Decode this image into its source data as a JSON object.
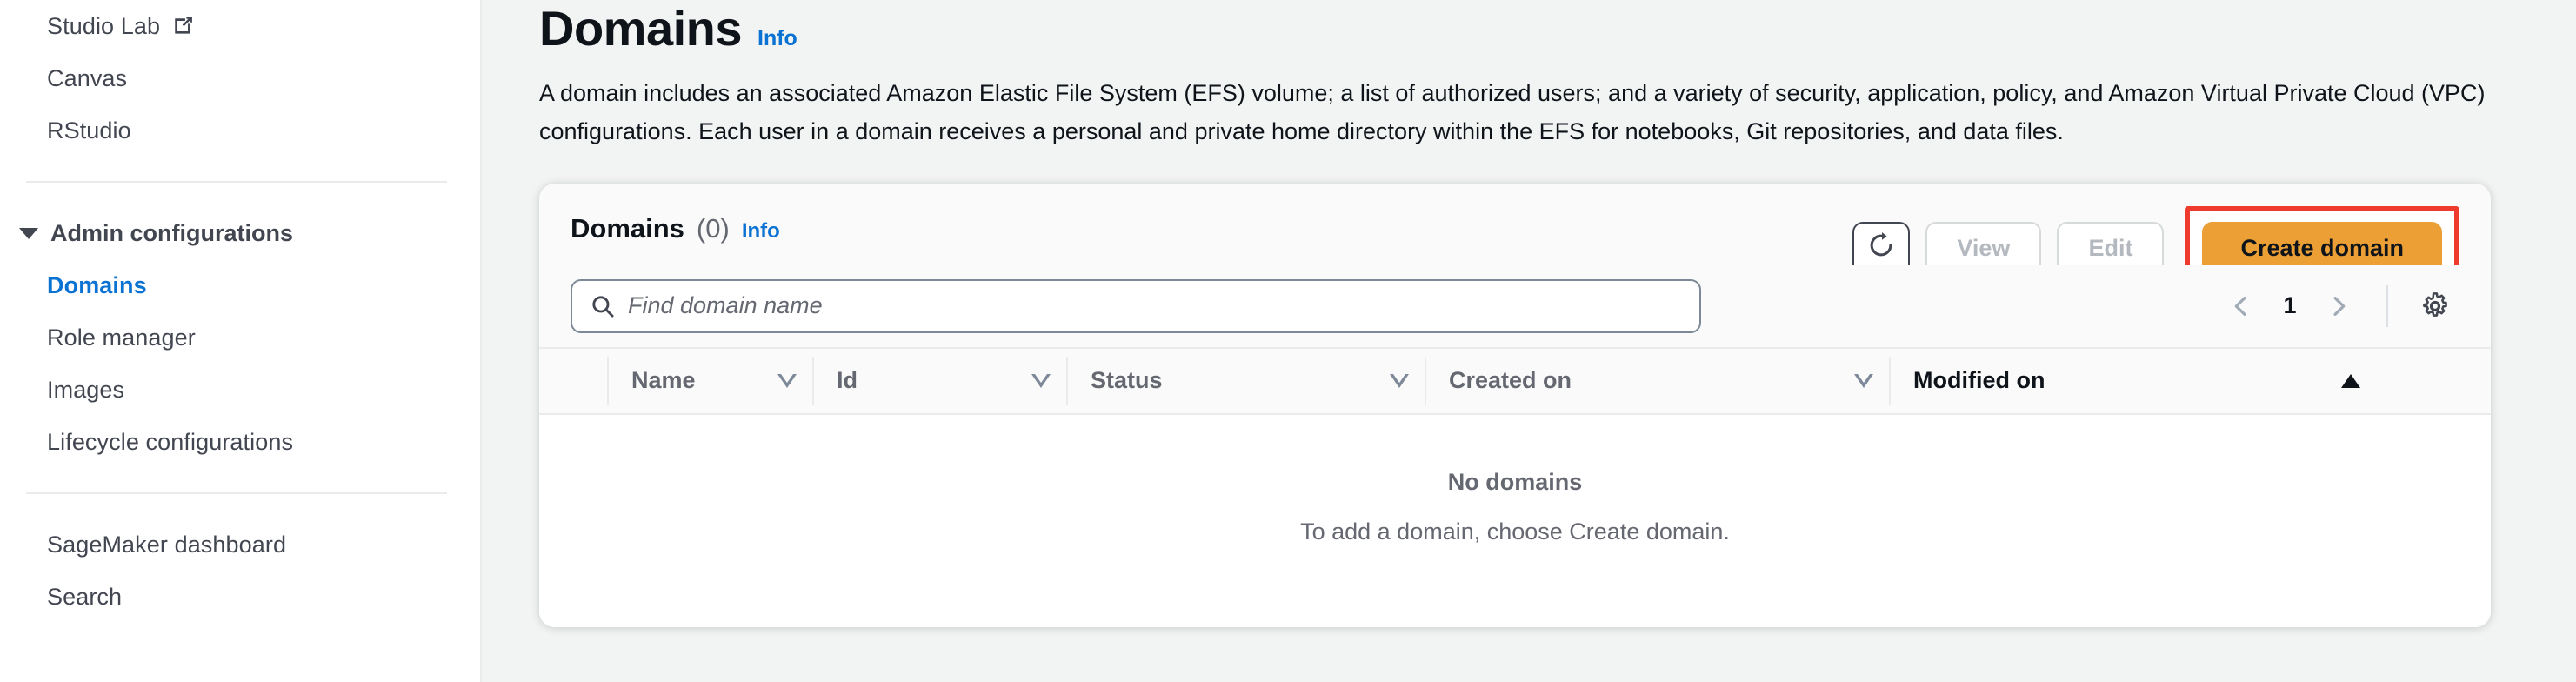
{
  "sidebar": {
    "items": [
      {
        "label": "Studio Lab",
        "external": true,
        "active": false
      },
      {
        "label": "Canvas",
        "external": false,
        "active": false
      },
      {
        "label": "RStudio",
        "external": false,
        "active": false
      }
    ],
    "group": {
      "label": "Admin configurations",
      "items": [
        {
          "label": "Domains",
          "active": true
        },
        {
          "label": "Role manager",
          "active": false
        },
        {
          "label": "Images",
          "active": false
        },
        {
          "label": "Lifecycle configurations",
          "active": false
        }
      ]
    },
    "footer_items": [
      {
        "label": "SageMaker dashboard"
      },
      {
        "label": "Search"
      }
    ]
  },
  "page": {
    "title": "Domains",
    "info_label": "Info",
    "description": "A domain includes an associated Amazon Elastic File System (EFS) volume; a list of authorized users; and a variety of security, application, policy, and Amazon Virtual Private Cloud (VPC) configurations. Each user in a domain receives a personal and private home directory within the EFS for notebooks, Git repositories, and data files."
  },
  "card": {
    "title": "Domains",
    "count": "(0)",
    "info_label": "Info",
    "actions": {
      "refresh_icon": "refresh-icon",
      "view_label": "View",
      "edit_label": "Edit",
      "create_label": "Create domain"
    },
    "search": {
      "placeholder": "Find domain name",
      "value": "",
      "icon": "search-icon"
    },
    "pagination": {
      "prev_icon": "chevron-left-icon",
      "page": "1",
      "next_icon": "chevron-right-icon",
      "settings_icon": "gear-icon"
    },
    "table": {
      "columns": [
        {
          "label": "Name",
          "sort": "down",
          "active": false
        },
        {
          "label": "Id",
          "sort": "down",
          "active": false
        },
        {
          "label": "Status",
          "sort": "down",
          "active": false
        },
        {
          "label": "Created on",
          "sort": "down",
          "active": false
        },
        {
          "label": "Modified on",
          "sort": "up",
          "active": true
        }
      ],
      "rows": [],
      "empty_title": "No domains",
      "empty_subtitle": "To add a domain, choose Create domain."
    }
  },
  "colors": {
    "accent_link": "#0972d3",
    "primary_button": "#eb9f35",
    "highlight": "#ef3b2d",
    "text": "#0f141a",
    "muted_text": "#656871",
    "page_bg": "#f2f3f3"
  }
}
